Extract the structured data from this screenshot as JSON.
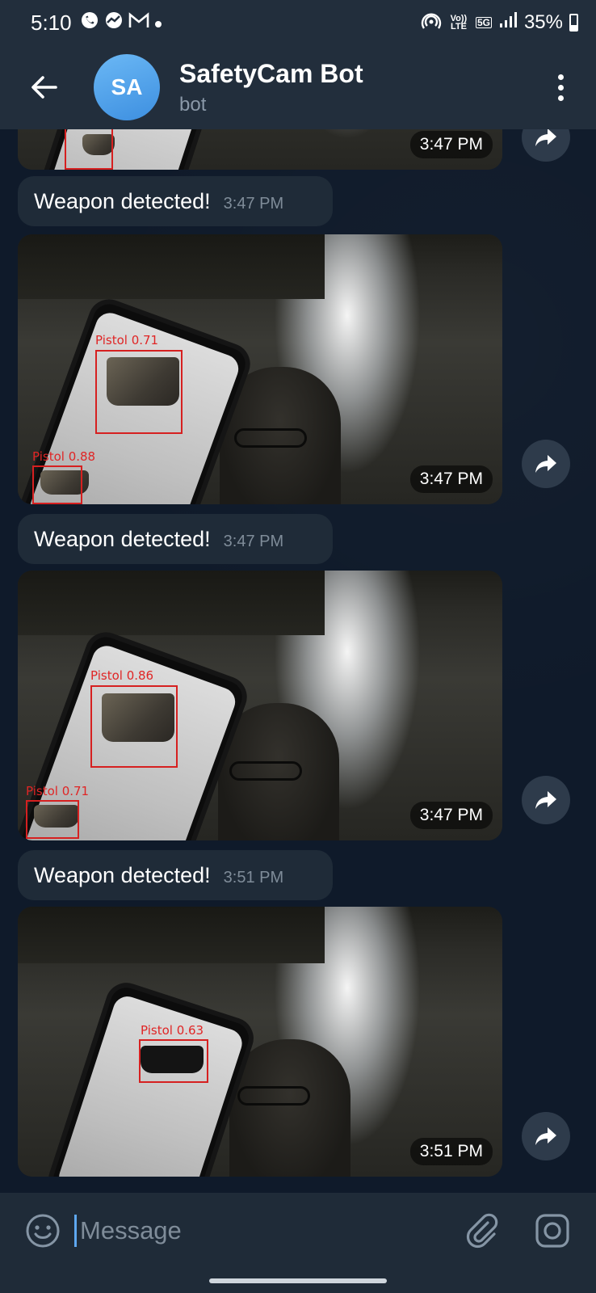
{
  "status": {
    "time": "5:10",
    "network": "5G",
    "volte": "Vo)) LTE",
    "battery": "35%",
    "icons": [
      "whatsapp-icon",
      "chart-icon",
      "gmail-icon",
      "dot-icon",
      "hotspot-icon",
      "volte-icon",
      "5g-icon",
      "signal-icon",
      "battery-icon"
    ]
  },
  "header": {
    "avatar_initials": "SA",
    "title": "SafetyCam Bot",
    "subtitle": "bot",
    "avatar_color": "#4a9ae8"
  },
  "messages": [
    {
      "type": "photo",
      "time": "3:47 PM"
    },
    {
      "type": "text",
      "text": "Weapon detected!",
      "time": "3:47 PM"
    },
    {
      "type": "photo",
      "time": "3:47 PM",
      "detections": [
        "Pistol  0.71",
        "Pistol  0.88"
      ]
    },
    {
      "type": "text",
      "text": "Weapon detected!",
      "time": "3:47 PM"
    },
    {
      "type": "photo",
      "time": "3:47 PM",
      "detections": [
        "Pistol  0.86",
        "Pistol  0.71"
      ]
    },
    {
      "type": "text",
      "text": "Weapon detected!",
      "time": "3:51 PM"
    },
    {
      "type": "photo",
      "time": "3:51 PM",
      "detections": [
        "Pistol  0.63"
      ]
    }
  ],
  "composer": {
    "placeholder": "Message"
  },
  "colors": {
    "background": "#0e1621",
    "header": "#222e3c",
    "bubble": "#1f2b38",
    "detection_box": "#d62020",
    "caret": "#5ea8f0"
  }
}
